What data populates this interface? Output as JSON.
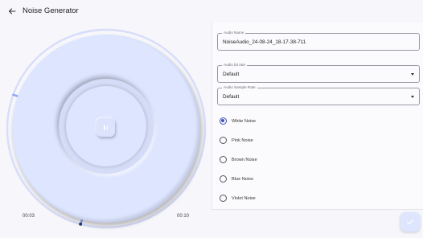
{
  "appbar": {
    "title": "Noise Generator",
    "back_icon": "arrow-left-icon"
  },
  "player": {
    "elapsed": "00:03",
    "total": "00:10",
    "progress_fraction": 0.08,
    "pause_icon": "pause-icon",
    "colors": {
      "disc": "#dde5ff",
      "progress": "#90a4f0",
      "knob": "#2c3e70"
    }
  },
  "form": {
    "audio_name": {
      "label": "Audio Name",
      "value": "NoiseAudio_24-08-24_18-17-38-711"
    },
    "bit_rate": {
      "label": "Audio bit rate",
      "value": "Default"
    },
    "sample_rate": {
      "label": "Audio Sample Rate",
      "value": "Default"
    },
    "noise_types": [
      {
        "label": "White Noise",
        "selected": true
      },
      {
        "label": "Pink Noise",
        "selected": false
      },
      {
        "label": "Brown Noise",
        "selected": false
      },
      {
        "label": "Blue Noise",
        "selected": false
      },
      {
        "label": "Violet Noise",
        "selected": false
      }
    ],
    "accent_color": "#3f51b5"
  },
  "fab": {
    "icon": "check-icon"
  }
}
